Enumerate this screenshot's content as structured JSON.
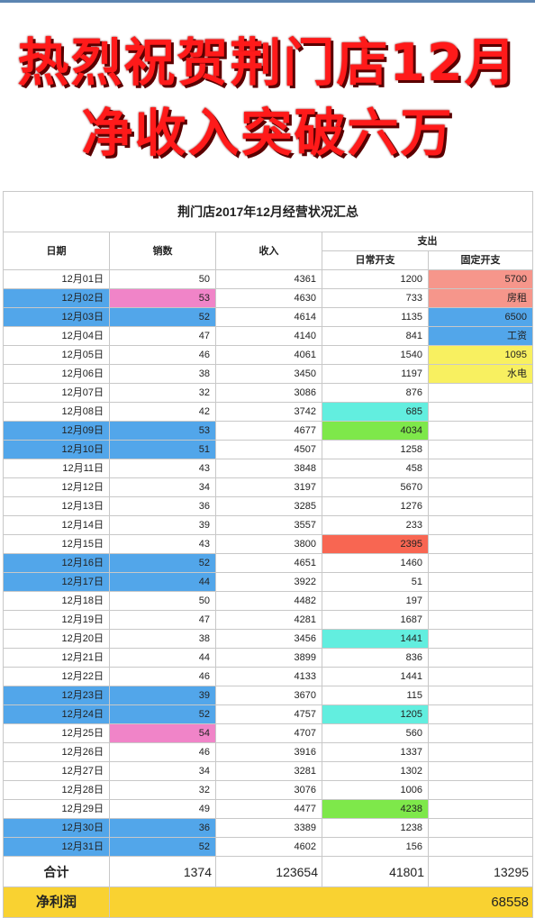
{
  "headline": {
    "line1": "热烈祝贺荆门店12月",
    "line2": "净收入突破六万",
    "color": "#ff1a1a"
  },
  "table": {
    "title": "荆门店2017年12月经营状况汇总",
    "headers": {
      "date": "日期",
      "sales": "销数",
      "income": "收入",
      "expense": "支出",
      "daily": "日常开支",
      "fixed": "固定开支"
    },
    "rows": [
      {
        "date": "12月01日",
        "sales": "50",
        "income": "4361",
        "daily": "1200",
        "fixed": "5700"
      },
      {
        "date": "12月02日",
        "sales": "53",
        "income": "4630",
        "daily": "733",
        "fixed": "房租"
      },
      {
        "date": "12月03日",
        "sales": "52",
        "income": "4614",
        "daily": "1135",
        "fixed": "6500"
      },
      {
        "date": "12月04日",
        "sales": "47",
        "income": "4140",
        "daily": "841",
        "fixed": "工资"
      },
      {
        "date": "12月05日",
        "sales": "46",
        "income": "4061",
        "daily": "1540",
        "fixed": "1095"
      },
      {
        "date": "12月06日",
        "sales": "38",
        "income": "3450",
        "daily": "1197",
        "fixed": "水电"
      },
      {
        "date": "12月07日",
        "sales": "32",
        "income": "3086",
        "daily": "876",
        "fixed": ""
      },
      {
        "date": "12月08日",
        "sales": "42",
        "income": "3742",
        "daily": "685",
        "fixed": ""
      },
      {
        "date": "12月09日",
        "sales": "53",
        "income": "4677",
        "daily": "4034",
        "fixed": ""
      },
      {
        "date": "12月10日",
        "sales": "51",
        "income": "4507",
        "daily": "1258",
        "fixed": ""
      },
      {
        "date": "12月11日",
        "sales": "43",
        "income": "3848",
        "daily": "458",
        "fixed": ""
      },
      {
        "date": "12月12日",
        "sales": "34",
        "income": "3197",
        "daily": "5670",
        "fixed": ""
      },
      {
        "date": "12月13日",
        "sales": "36",
        "income": "3285",
        "daily": "1276",
        "fixed": ""
      },
      {
        "date": "12月14日",
        "sales": "39",
        "income": "3557",
        "daily": "233",
        "fixed": ""
      },
      {
        "date": "12月15日",
        "sales": "43",
        "income": "3800",
        "daily": "2395",
        "fixed": ""
      },
      {
        "date": "12月16日",
        "sales": "52",
        "income": "4651",
        "daily": "1460",
        "fixed": ""
      },
      {
        "date": "12月17日",
        "sales": "44",
        "income": "3922",
        "daily": "51",
        "fixed": ""
      },
      {
        "date": "12月18日",
        "sales": "50",
        "income": "4482",
        "daily": "197",
        "fixed": ""
      },
      {
        "date": "12月19日",
        "sales": "47",
        "income": "4281",
        "daily": "1687",
        "fixed": ""
      },
      {
        "date": "12月20日",
        "sales": "38",
        "income": "3456",
        "daily": "1441",
        "fixed": ""
      },
      {
        "date": "12月21日",
        "sales": "44",
        "income": "3899",
        "daily": "836",
        "fixed": ""
      },
      {
        "date": "12月22日",
        "sales": "46",
        "income": "4133",
        "daily": "1441",
        "fixed": ""
      },
      {
        "date": "12月23日",
        "sales": "39",
        "income": "3670",
        "daily": "115",
        "fixed": ""
      },
      {
        "date": "12月24日",
        "sales": "52",
        "income": "4757",
        "daily": "1205",
        "fixed": ""
      },
      {
        "date": "12月25日",
        "sales": "54",
        "income": "4707",
        "daily": "560",
        "fixed": ""
      },
      {
        "date": "12月26日",
        "sales": "46",
        "income": "3916",
        "daily": "1337",
        "fixed": ""
      },
      {
        "date": "12月27日",
        "sales": "34",
        "income": "3281",
        "daily": "1302",
        "fixed": ""
      },
      {
        "date": "12月28日",
        "sales": "32",
        "income": "3076",
        "daily": "1006",
        "fixed": ""
      },
      {
        "date": "12月29日",
        "sales": "49",
        "income": "4477",
        "daily": "4238",
        "fixed": ""
      },
      {
        "date": "12月30日",
        "sales": "36",
        "income": "3389",
        "daily": "1238",
        "fixed": ""
      },
      {
        "date": "12月31日",
        "sales": "52",
        "income": "4602",
        "daily": "156",
        "fixed": ""
      }
    ],
    "total": {
      "label": "合计",
      "sales": "1374",
      "income": "123654",
      "daily": "41801",
      "fixed": "13295"
    },
    "net": {
      "label": "净利润",
      "value": "68558"
    }
  },
  "highlights": {
    "weekend_rows_color": "#52a6ea",
    "sales_pink": {
      "color": "#f084c8",
      "rows": [
        1,
        24
      ]
    },
    "daily_colors": {
      "7": "#62eedf",
      "8": "#7ee84a",
      "14": "#f86652",
      "19": "#62eedf",
      "23": "#62eedf",
      "28": "#7ee84a"
    },
    "fixed_colors": {
      "0": "#f6968b",
      "1": "#f6968b",
      "2": "#52a6ea",
      "3": "#52a6ea",
      "4": "#f8f060",
      "5": "#f8f060"
    },
    "weekend_rows": [
      1,
      2,
      8,
      9,
      15,
      16,
      22,
      23,
      29,
      30
    ],
    "net_row_color": "#f9d231"
  }
}
